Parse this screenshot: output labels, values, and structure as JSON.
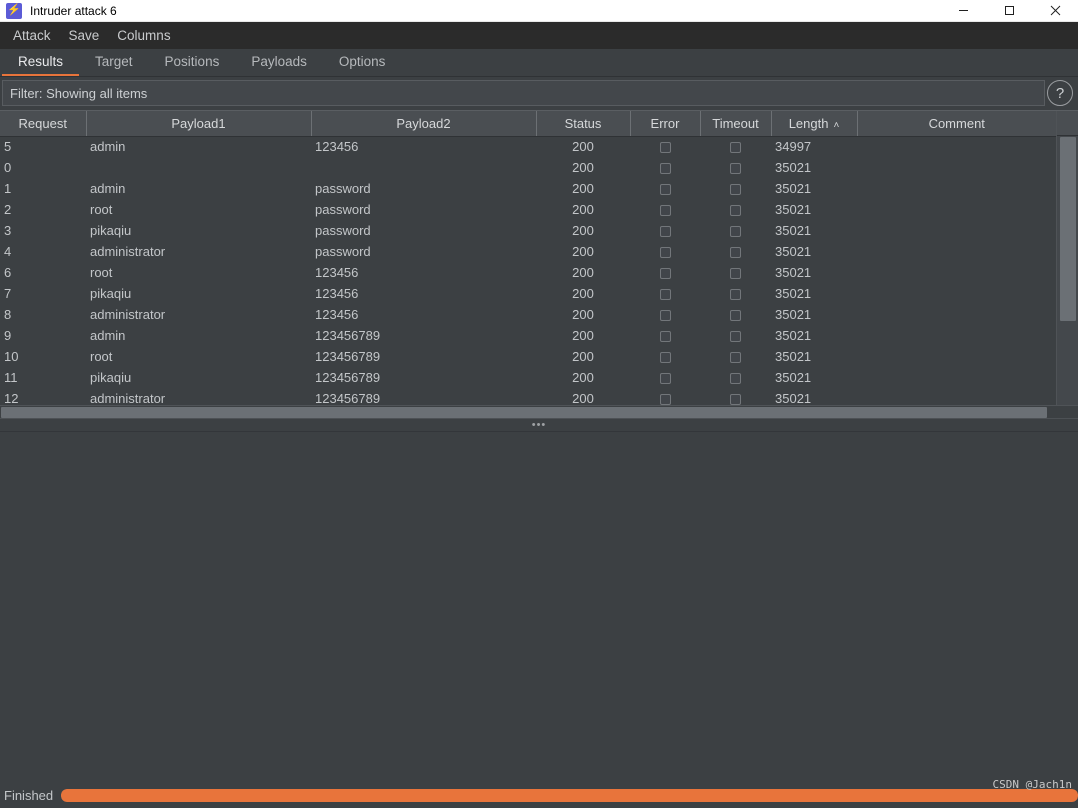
{
  "window": {
    "title": "Intruder attack 6",
    "icon": "lightning-bolt-icon",
    "minimize_label": "—",
    "maximize_label": "☐",
    "close_label": "✕"
  },
  "menubar": {
    "items": [
      {
        "label": "Attack"
      },
      {
        "label": "Save"
      },
      {
        "label": "Columns"
      }
    ]
  },
  "tabs": [
    {
      "label": "Results",
      "active": true
    },
    {
      "label": "Target",
      "active": false
    },
    {
      "label": "Positions",
      "active": false
    },
    {
      "label": "Payloads",
      "active": false
    },
    {
      "label": "Options",
      "active": false
    }
  ],
  "filter": {
    "text": "Filter: Showing all items",
    "help_label": "?"
  },
  "table": {
    "columns": [
      {
        "label": "Request",
        "key": "request"
      },
      {
        "label": "Payload1",
        "key": "payload1"
      },
      {
        "label": "Payload2",
        "key": "payload2"
      },
      {
        "label": "Status",
        "key": "status"
      },
      {
        "label": "Error",
        "key": "error"
      },
      {
        "label": "Timeout",
        "key": "timeout"
      },
      {
        "label": "Length",
        "key": "length",
        "sort": "asc",
        "sort_caret": "˄"
      },
      {
        "label": "Comment",
        "key": "comment"
      }
    ],
    "rows": [
      {
        "request": "5",
        "payload1": "admin",
        "payload2": "123456",
        "status": "200",
        "error": false,
        "timeout": false,
        "length": "34997",
        "comment": ""
      },
      {
        "request": "0",
        "payload1": "",
        "payload2": "",
        "status": "200",
        "error": false,
        "timeout": false,
        "length": "35021",
        "comment": ""
      },
      {
        "request": "1",
        "payload1": "admin",
        "payload2": "password",
        "status": "200",
        "error": false,
        "timeout": false,
        "length": "35021",
        "comment": ""
      },
      {
        "request": "2",
        "payload1": "root",
        "payload2": "password",
        "status": "200",
        "error": false,
        "timeout": false,
        "length": "35021",
        "comment": ""
      },
      {
        "request": "3",
        "payload1": "pikaqiu",
        "payload2": "password",
        "status": "200",
        "error": false,
        "timeout": false,
        "length": "35021",
        "comment": ""
      },
      {
        "request": "4",
        "payload1": "administrator",
        "payload2": "password",
        "status": "200",
        "error": false,
        "timeout": false,
        "length": "35021",
        "comment": ""
      },
      {
        "request": "6",
        "payload1": "root",
        "payload2": "123456",
        "status": "200",
        "error": false,
        "timeout": false,
        "length": "35021",
        "comment": ""
      },
      {
        "request": "7",
        "payload1": "pikaqiu",
        "payload2": "123456",
        "status": "200",
        "error": false,
        "timeout": false,
        "length": "35021",
        "comment": ""
      },
      {
        "request": "8",
        "payload1": "administrator",
        "payload2": "123456",
        "status": "200",
        "error": false,
        "timeout": false,
        "length": "35021",
        "comment": ""
      },
      {
        "request": "9",
        "payload1": "admin",
        "payload2": "123456789",
        "status": "200",
        "error": false,
        "timeout": false,
        "length": "35021",
        "comment": ""
      },
      {
        "request": "10",
        "payload1": "root",
        "payload2": "123456789",
        "status": "200",
        "error": false,
        "timeout": false,
        "length": "35021",
        "comment": ""
      },
      {
        "request": "11",
        "payload1": "pikaqiu",
        "payload2": "123456789",
        "status": "200",
        "error": false,
        "timeout": false,
        "length": "35021",
        "comment": ""
      },
      {
        "request": "12",
        "payload1": "administrator",
        "payload2": "123456789",
        "status": "200",
        "error": false,
        "timeout": false,
        "length": "35021",
        "comment": ""
      }
    ]
  },
  "splitter": {
    "handle": "•••"
  },
  "statusbar": {
    "status": "Finished",
    "progress_percent": 100
  },
  "watermark": {
    "text": "CSDN @Jach1n"
  },
  "colors": {
    "accent": "#e8743b",
    "background": "#3c4043",
    "menubar": "#2b2b2b",
    "header": "#4a4e52",
    "text": "#c3c6c9",
    "titlebar": "#ffffff",
    "icon_purple": "#5b5bd6"
  }
}
